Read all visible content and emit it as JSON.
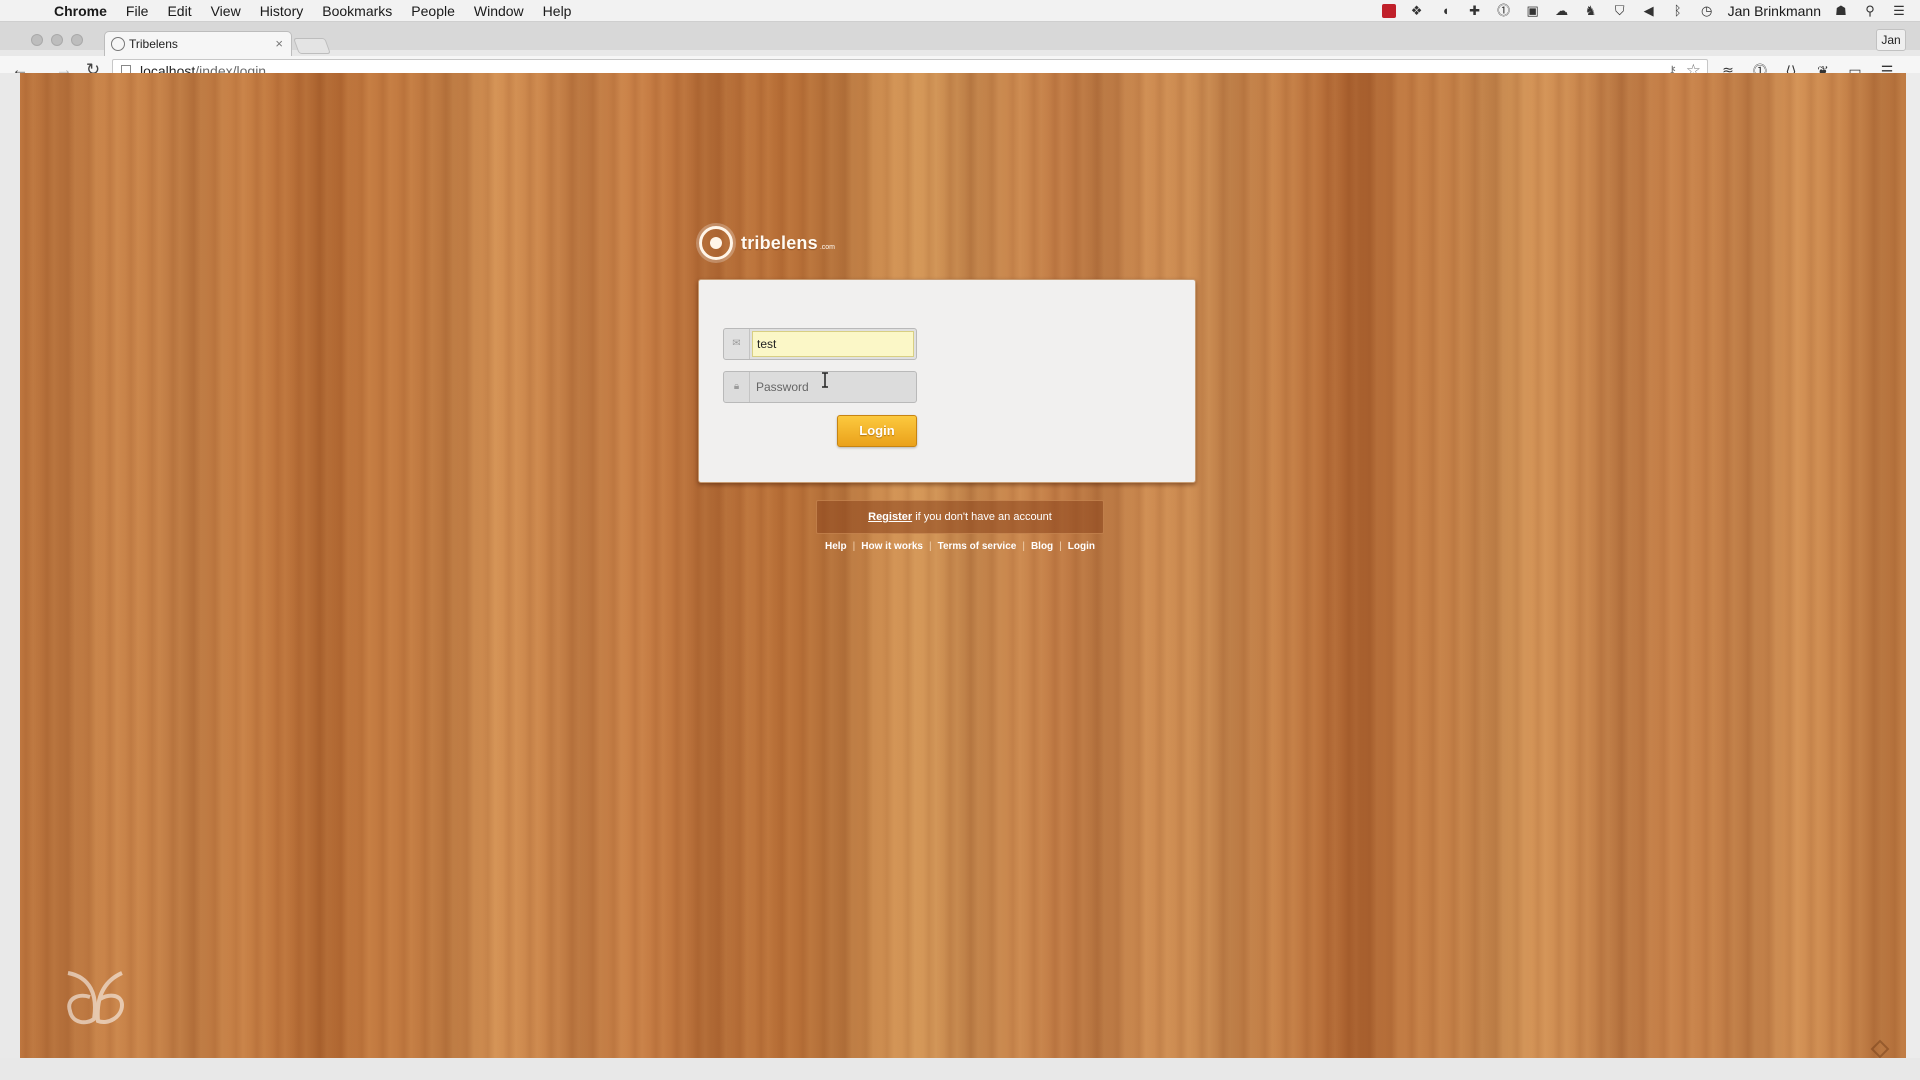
{
  "menubar": {
    "apple_glyph": "",
    "items": [
      "Chrome",
      "File",
      "Edit",
      "View",
      "History",
      "Bookmarks",
      "People",
      "Window",
      "Help"
    ],
    "username": "Jan Brinkmann"
  },
  "browser": {
    "tab": {
      "title": "Tribelens",
      "close_glyph": "×"
    },
    "profile_label": "Jan",
    "url": {
      "host": "localhost",
      "path": "/index/login"
    }
  },
  "page": {
    "brand": {
      "name": "tribelens",
      "tld": ".com"
    },
    "login_form": {
      "username_value": "test",
      "password_placeholder": "Password",
      "submit_label": "Login"
    },
    "register": {
      "link_text": "Register",
      "suffix": " if you don't have an account"
    },
    "footer_links": [
      "Help",
      "How it works",
      "Terms of service",
      "Blog",
      "Login"
    ],
    "separator": "|"
  },
  "colors": {
    "login_button": "#f4b42a",
    "autofill_field": "#fbf7c7",
    "wood_base": "#c47a42"
  }
}
